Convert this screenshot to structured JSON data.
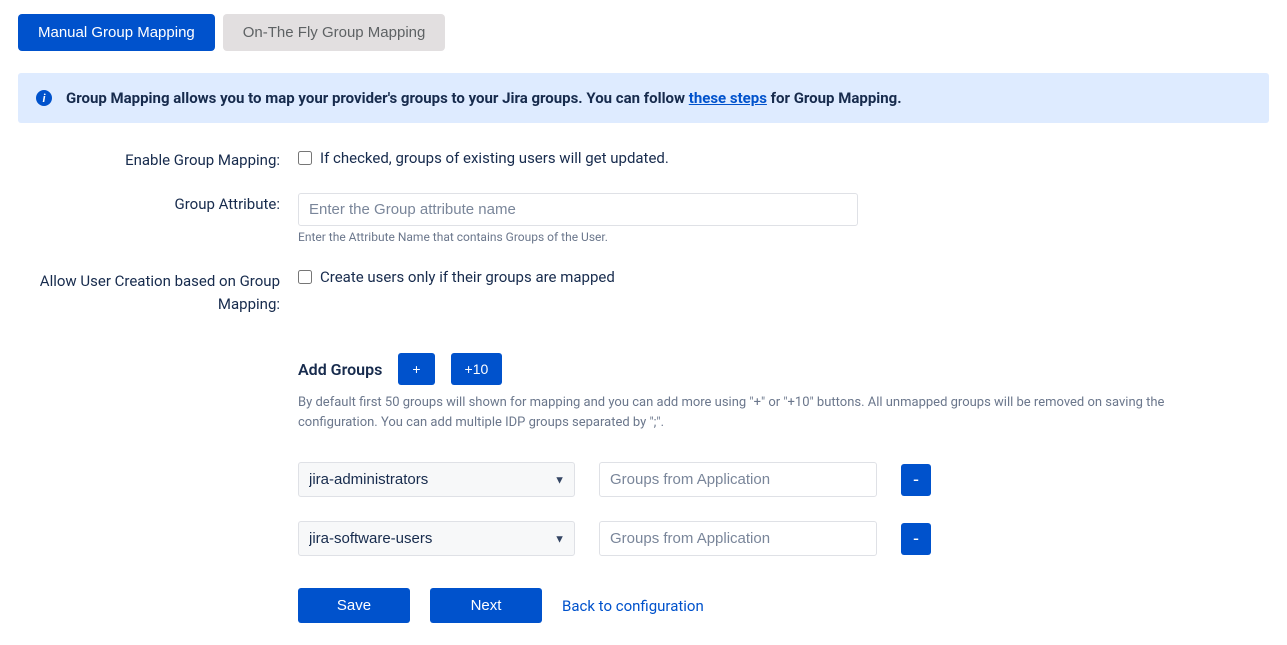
{
  "tabs": {
    "manual": "Manual Group Mapping",
    "onthefly": "On-The Fly Group Mapping"
  },
  "info": {
    "prefix": "Group Mapping allows you to map your provider's groups to your Jira groups. You can follow ",
    "link": "these steps",
    "suffix": " for Group Mapping."
  },
  "labels": {
    "enable": "Enable Group Mapping:",
    "attribute": "Group Attribute:",
    "allow": "Allow User Creation based on Group Mapping:"
  },
  "fields": {
    "enable_checkbox_label": "If checked, groups of existing users will get updated.",
    "attribute_placeholder": "Enter the Group attribute name",
    "attribute_helper": "Enter the Attribute Name that contains Groups of the User.",
    "allow_checkbox_label": "Create users only if their groups are mapped"
  },
  "add_groups": {
    "title": "Add Groups",
    "plus": "+",
    "plus10": "+10",
    "helper": "By default first 50 groups will shown for mapping and you can add more using \"+\" or \"+10\" buttons. All unmapped groups will be removed on saving the configuration. You can add multiple IDP groups separated by \";\"."
  },
  "group_rows": [
    {
      "selected": "jira-administrators",
      "placeholder": "Groups from Application",
      "remove": "-"
    },
    {
      "selected": "jira-software-users",
      "placeholder": "Groups from Application",
      "remove": "-"
    }
  ],
  "actions": {
    "save": "Save",
    "next": "Next",
    "back": "Back to configuration"
  }
}
